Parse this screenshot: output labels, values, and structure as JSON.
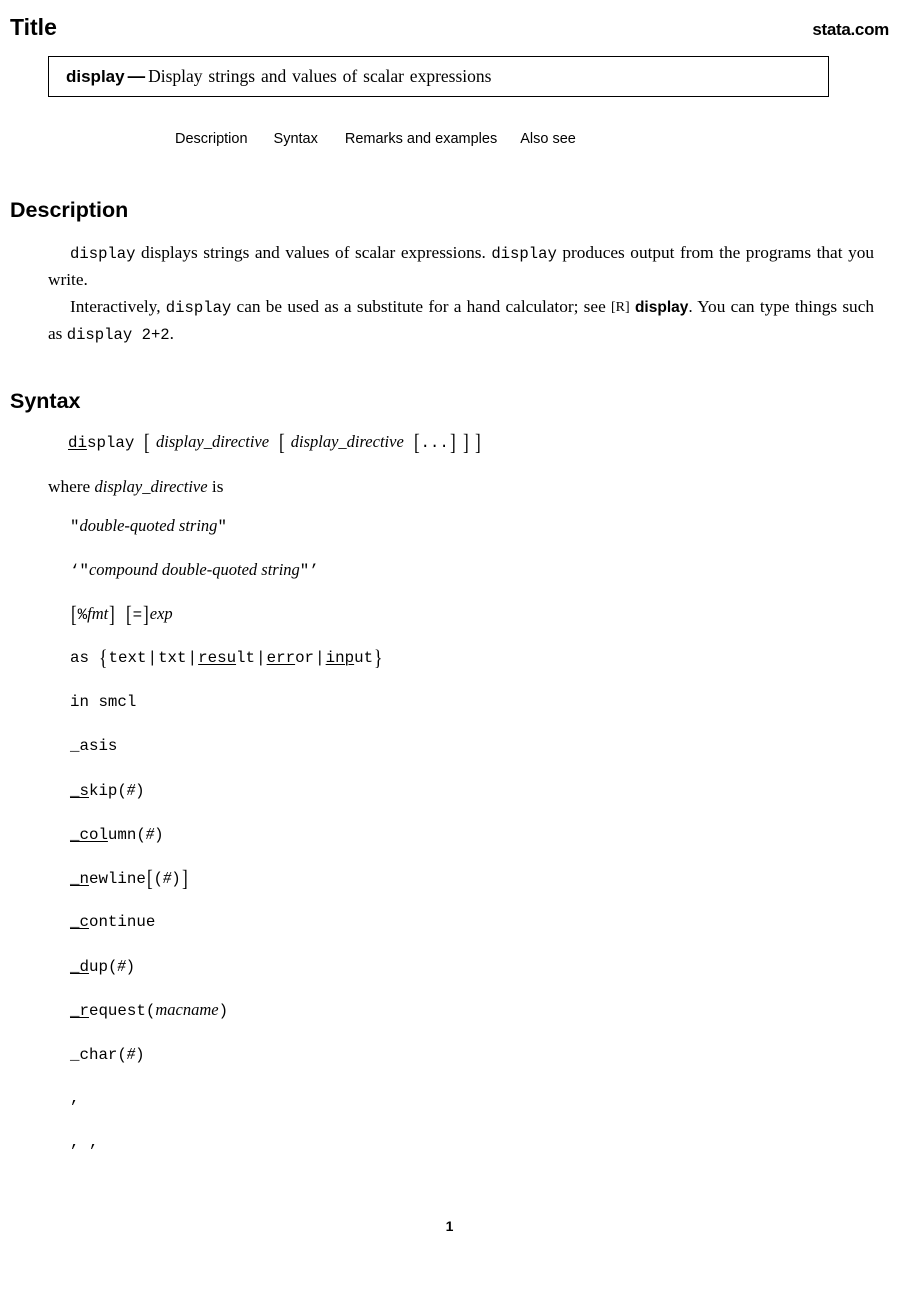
{
  "header": {
    "title": "Title",
    "logo": "stata.com"
  },
  "title_box": {
    "command": "display",
    "dash": "—",
    "description": "Display strings and values of scalar expressions"
  },
  "nav": {
    "items": [
      {
        "label": "Description"
      },
      {
        "label": "Syntax"
      },
      {
        "label": "Remarks and examples"
      },
      {
        "label": "Also see"
      }
    ]
  },
  "description": {
    "heading": "Description",
    "paragraph_1": {
      "seg_1_code": "display",
      "seg_2_text": " displays strings and values of scalar expressions. ",
      "seg_3_code": "display",
      "seg_4_text": " produces output from the programs that you write."
    },
    "paragraph_2": {
      "seg_1_text": "Interactively, ",
      "seg_2_code": "display",
      "seg_3_text": " can be used as a substitute for a hand calculator; see ",
      "seg_4_ref_bracket": "[R]",
      "seg_5_ref_name": "display",
      "seg_6_text": ". You can type things such as ",
      "seg_7_code": "display 2+2",
      "seg_8_text": "."
    }
  },
  "syntax": {
    "heading": "Syntax",
    "main": {
      "cmd_underlined": "di",
      "cmd_rest": "splay",
      "bracket_open": "[",
      "arg_1": "display_directive",
      "arg_2": "display_directive",
      "ellipsis": "...",
      "bracket_close": "]"
    },
    "where_line": {
      "prefix": "where ",
      "term": "display_directive",
      "suffix": " is"
    },
    "directives": [
      {
        "name": "double-quoted-string",
        "parts": [
          {
            "type": "mono",
            "text": "\""
          },
          {
            "type": "italic",
            "text": "double-quoted string"
          },
          {
            "type": "mono",
            "text": "\""
          }
        ]
      },
      {
        "name": "compound-double-quoted-string",
        "parts": [
          {
            "type": "mono",
            "text": "‘"
          },
          {
            "type": "mono",
            "text": "\""
          },
          {
            "type": "italic",
            "text": "compound double-quoted string"
          },
          {
            "type": "mono",
            "text": "\""
          },
          {
            "type": "mono",
            "text": "’"
          }
        ]
      },
      {
        "name": "fmt-exp",
        "parts": [
          {
            "type": "bracket",
            "text": "["
          },
          {
            "type": "mono",
            "text": "%"
          },
          {
            "type": "italic",
            "text": "fmt"
          },
          {
            "type": "bracket",
            "text": "]"
          },
          {
            "type": "gap"
          },
          {
            "type": "bracket",
            "text": "["
          },
          {
            "type": "mono",
            "text": "="
          },
          {
            "type": "bracket",
            "text": "]"
          },
          {
            "type": "italic",
            "text": "exp"
          }
        ]
      },
      {
        "name": "as-style",
        "parts": [
          {
            "type": "mono",
            "text": "as"
          },
          {
            "type": "gap"
          },
          {
            "type": "brace",
            "text": "{"
          },
          {
            "type": "mono",
            "text": "text"
          },
          {
            "type": "bar",
            "text": "|"
          },
          {
            "type": "mono",
            "text": "txt"
          },
          {
            "type": "bar",
            "text": "|"
          },
          {
            "type": "mono-underline",
            "text": "resu",
            "rest": "lt"
          },
          {
            "type": "bar",
            "text": "|"
          },
          {
            "type": "mono-underline",
            "text": "err",
            "rest": "or"
          },
          {
            "type": "bar",
            "text": "|"
          },
          {
            "type": "mono-underline",
            "text": "inp",
            "rest": "ut"
          },
          {
            "type": "brace",
            "text": "}"
          }
        ]
      },
      {
        "name": "in-smcl",
        "parts": [
          {
            "type": "mono",
            "text": "in smcl"
          }
        ]
      },
      {
        "name": "asis",
        "parts": [
          {
            "type": "mono",
            "text": "_asis"
          }
        ]
      },
      {
        "name": "skip",
        "parts": [
          {
            "type": "mono-underline",
            "text": "_s",
            "rest": "kip"
          },
          {
            "type": "mono",
            "text": "("
          },
          {
            "type": "italic",
            "text": "#"
          },
          {
            "type": "mono",
            "text": ")"
          }
        ]
      },
      {
        "name": "column",
        "parts": [
          {
            "type": "mono-underline",
            "text": "_col",
            "rest": "umn"
          },
          {
            "type": "mono",
            "text": "("
          },
          {
            "type": "italic",
            "text": "#"
          },
          {
            "type": "mono",
            "text": ")"
          }
        ]
      },
      {
        "name": "newline",
        "parts": [
          {
            "type": "mono-underline",
            "text": "_n",
            "rest": "ewline"
          },
          {
            "type": "bracket",
            "text": "["
          },
          {
            "type": "mono",
            "text": "("
          },
          {
            "type": "italic",
            "text": "#"
          },
          {
            "type": "mono",
            "text": ")"
          },
          {
            "type": "bracket",
            "text": "]"
          }
        ]
      },
      {
        "name": "continue",
        "parts": [
          {
            "type": "mono-underline",
            "text": "_c",
            "rest": "ontinue"
          }
        ]
      },
      {
        "name": "dup",
        "parts": [
          {
            "type": "mono-underline",
            "text": "_d",
            "rest": "up"
          },
          {
            "type": "mono",
            "text": "("
          },
          {
            "type": "italic",
            "text": "#"
          },
          {
            "type": "mono",
            "text": ")"
          }
        ]
      },
      {
        "name": "request",
        "parts": [
          {
            "type": "mono-underline",
            "text": "_r",
            "rest": "equest"
          },
          {
            "type": "mono",
            "text": "("
          },
          {
            "type": "italic",
            "text": "macname"
          },
          {
            "type": "mono",
            "text": ")"
          }
        ]
      },
      {
        "name": "char",
        "parts": [
          {
            "type": "mono",
            "text": "_char"
          },
          {
            "type": "mono",
            "text": "("
          },
          {
            "type": "italic",
            "text": "#"
          },
          {
            "type": "mono",
            "text": ")"
          }
        ]
      },
      {
        "name": "comma",
        "parts": [
          {
            "type": "mono",
            "text": ","
          }
        ]
      },
      {
        "name": "double-comma",
        "parts": [
          {
            "type": "mono",
            "text": ", ,"
          }
        ]
      }
    ]
  },
  "footer": {
    "page_number": "1"
  }
}
